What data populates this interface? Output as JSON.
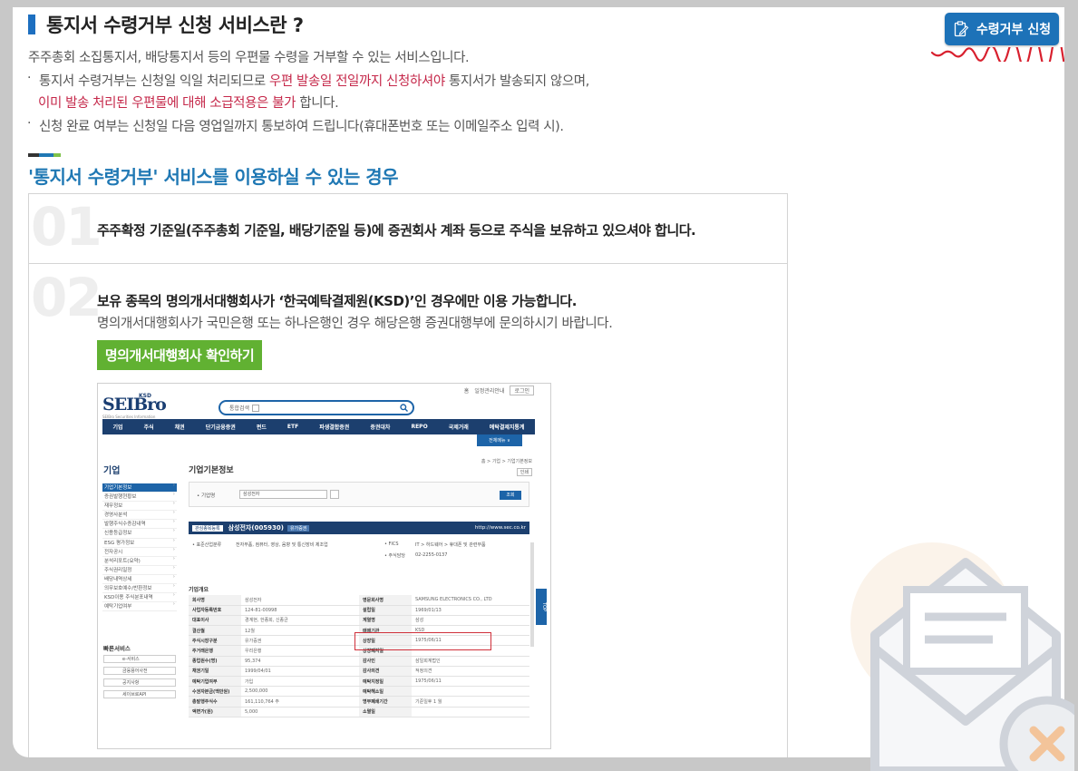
{
  "header": {
    "title": "통지서 수령거부 신청 서비스란 ?",
    "apply_button": "수령거부 신청"
  },
  "intro": {
    "line1": "주주총회 소집통지서, 배당통지서 등의 우편물 수령을 거부할 수 있는 서비스입니다.",
    "bullet": "·",
    "line2_a": "통지서 수령거부는 신청일 익일 처리되므로 ",
    "line2_red": "우편 발송일 전일까지 신청하셔야",
    "line2_b": " 통지서가 발송되지 않으며,",
    "line3_red": "이미 발송 처리된 우편물에 대해 소급적용은 불가",
    "line3_b": " 합니다.",
    "line4": "신청 완료 여부는 신청일 다음 영업일까지 통보하여 드립니다(휴대폰번호 또는 이메일주소 입력 시)."
  },
  "section": {
    "title": "'통지서 수령거부' 서비스를 이용하실 수 있는 경우",
    "items": [
      {
        "num": "01",
        "text": "주주확정 기준일(주주총회 기준일, 배당기준일 등)에 증권회사 계좌 등으로 주식을 보유하고 있으셔야 합니다."
      },
      {
        "num": "02",
        "text": "보유 종목의 명의개서대행회사가 ‘한국예탁결제원(KSD)’인 경우에만 이용 가능합니다.",
        "sub": "명의개서대행회사가 국민은행 또는 하나은행인 경우 해당은행 증권대행부에 문의하시기 바랍니다."
      }
    ],
    "check_button": "명의개서대행회사 확인하기"
  },
  "screenshot": {
    "toplinks": [
      "홈",
      "일정관리안내",
      "로그인"
    ],
    "logo": "SEIBro",
    "logo_ksd": "KSD",
    "logo_tag": "SEIBro Securities Information Breaking",
    "search_label": "통합검색",
    "nav": [
      "기업",
      "주식",
      "채권",
      "단기금융증권",
      "펀드",
      "ETF",
      "파생결합증권",
      "증권대차",
      "REPO",
      "국제거래",
      "예탁결제지통계"
    ],
    "nav_all": "전체메뉴  ∨",
    "side_title": "기업",
    "side_items": [
      "기업기본정보",
      "증권발행현황보",
      "재무정보",
      "경영사분석",
      "발행주식수증감내역",
      "신용등급정보",
      "ESG 평가정보",
      "전자공시",
      "분석리포트(요약)",
      "주식권리일정",
      "배당내역상세",
      "의무보호예수/반환정보",
      "KSD이용 주식분포내역",
      "예탁기업여부"
    ],
    "quick_title": "빠른서비스",
    "quick_items": [
      "e-서비스",
      "금융용어사전",
      "공지사항",
      "세이브로API"
    ],
    "page_title": "기업기본정보",
    "crumb": "홈 > 기업 > 기업기본정보",
    "print": "인쇄",
    "search_field_label": "• 기업명",
    "search_field_value": "삼성전자",
    "search_go": "조회",
    "corp_tag": "관심종목등록",
    "corp_name": "삼성전자(005930)",
    "corp_tag2": "유가증권",
    "corp_url": "http://www.sec.co.kr",
    "industry_label": "• 표준산업분류",
    "industry_value": "전자부품, 컴퓨터, 영상, 음향 및 통신장비 제조업",
    "fics_label": "• FICS",
    "fics_value": "IT > 하드웨어 > 휴대폰 및 관련부품",
    "contact_label": "• 주식담당",
    "contact_value": "02-2255-0137",
    "overview_title": "기업개요",
    "table": [
      [
        "회사명",
        "삼성전자",
        "영문회사명",
        "SAMSUNG ELECTRONICS CO., LTD"
      ],
      [
        "사업자등록번호",
        "124-81-00998",
        "설립일",
        "1969/01/13"
      ],
      [
        "대표이사",
        "경계현, 한종희, 신종균",
        "계열명",
        "삼성"
      ],
      [
        "결산월",
        "12월",
        "매매기관",
        "KSD"
      ],
      [
        "주식시장구분",
        "유가증권",
        "상장일",
        "1975/06/11"
      ],
      [
        "주거래은행",
        "우리은행",
        "상장폐지일",
        ""
      ],
      [
        "종업원수(명)",
        "95,374",
        "감사인",
        "삼일회계법인"
      ],
      [
        "채권기일",
        "1999/04/01",
        "감사의견",
        "적정의견"
      ],
      [
        "예탁기업여부",
        "가입",
        "예탁지정일",
        "1975/06/11"
      ],
      [
        "수권자본금(백만원)",
        "2,500,000",
        "예탁해소일",
        ""
      ],
      [
        "총발행주식수",
        "161,110,764 주",
        "명부폐쇄기간",
        "기준일후 1 월"
      ],
      [
        "액면가(원)",
        "5,000",
        "소멸일",
        ""
      ]
    ],
    "float_btn": "TOP"
  },
  "colors": {
    "accent_blue": "#1d72b8",
    "title_blue": "#1f78b4",
    "warn_red": "#c5284a",
    "green": "#61b132",
    "squiggle_red": "#d8202e"
  }
}
